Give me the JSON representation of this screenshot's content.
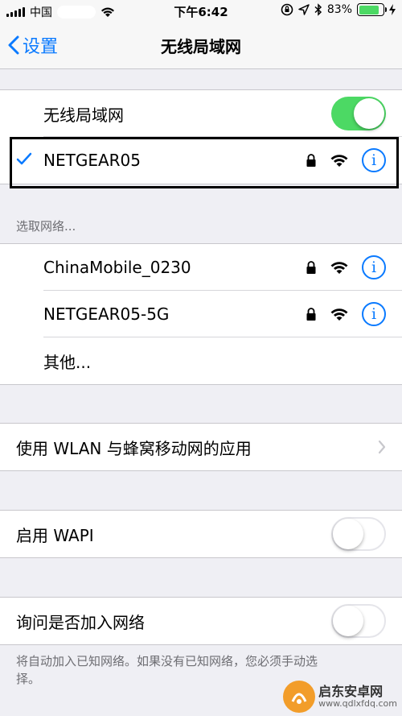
{
  "status_bar": {
    "carrier": "中国",
    "time": "下午6:42",
    "battery": "83%"
  },
  "nav": {
    "back_label": "设置",
    "title": "无线局域网"
  },
  "wlan_toggle": {
    "label": "无线局域网",
    "state": "on"
  },
  "connected_network": {
    "name": "NETGEAR05",
    "secured": true
  },
  "choose_network": {
    "header": "选取网络...",
    "networks": [
      {
        "name": "ChinaMobile_0230",
        "secured": true
      },
      {
        "name": "NETGEAR05-5G",
        "secured": true
      }
    ],
    "other_label": "其他..."
  },
  "wlan_apps": {
    "label": "使用 WLAN 与蜂窝移动网的应用"
  },
  "wapi": {
    "label": "启用 WAPI",
    "state": "off"
  },
  "ask_join": {
    "label": "询问是否加入网络",
    "state": "off",
    "note": "将自动加入已知网络。如果没有已知网络，您必须手动选择。"
  },
  "watermark": {
    "title": "启东安卓网",
    "url": "www.qdlxfdq.com"
  },
  "colors": {
    "accent": "#0a7aff",
    "toggle_on": "#4cd964",
    "background": "#efeff4"
  }
}
